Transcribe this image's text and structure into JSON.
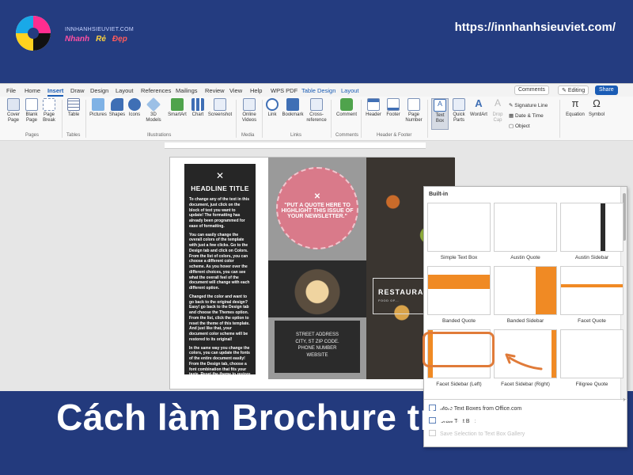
{
  "banner": {
    "logo_text": "INNHANHSIEUVIET.COM",
    "tagline_1": "Nhanh",
    "tagline_2": "Rẻ",
    "tagline_3": "Đẹp",
    "url": "https://innhanhsieuviet.com/"
  },
  "menu": {
    "tabs": [
      "File",
      "Home",
      "Insert",
      "Draw",
      "Design",
      "Layout",
      "References",
      "Mailings",
      "Review",
      "View",
      "Help",
      "WPS PDF",
      "Table Design",
      "Layout"
    ],
    "active_tab": "Insert",
    "comments_label": "Comments",
    "editing_label": "Editing",
    "share_label": "Share"
  },
  "ribbon": {
    "pages": {
      "cover": "Cover Page",
      "blank": "Blank Page",
      "break": "Page Break",
      "label": "Pages"
    },
    "tables": {
      "table": "Table",
      "label": "Tables"
    },
    "illustrations": {
      "pictures": "Pictures",
      "shapes": "Shapes",
      "icons": "Icons",
      "models": "3D Models",
      "smartart": "SmartArt",
      "chart": "Chart",
      "screenshot": "Screenshot",
      "label": "Illustrations"
    },
    "media": {
      "video": "Online Videos",
      "label": "Media"
    },
    "links": {
      "link": "Link",
      "bookmark": "Bookmark",
      "crossref": "Cross-reference",
      "label": "Links"
    },
    "comments": {
      "comment": "Comment",
      "label": "Comments"
    },
    "header_footer": {
      "header": "Header",
      "footer": "Footer",
      "page_number": "Page Number",
      "label": "Header & Footer"
    },
    "text": {
      "textbox": "Text Box",
      "quickparts": "Quick Parts",
      "wordart": "WordArt",
      "dropcap": "Drop Cap",
      "signature": "Signature Line",
      "datetime": "Date & Time",
      "object": "Object"
    },
    "symbols": {
      "equation": "Equation",
      "symbol": "Symbol"
    }
  },
  "brochure": {
    "headline": "HEADLINE TITLE",
    "paragraphs": [
      "To change any of the text in this document, just click on the block of text you want to update! The formatting has already been programmed for ease of formatting.",
      "You can easily change the overall colors of the template with just a few clicks. Go to the Design tab and click on Colors. From the list of colors, you can choose a different color scheme. As you hover over the different choices, you can see what the overall feel of the document will change with each different option.",
      "Changed the color and want to go back to the original design? Easy! go back to the Design tab and choose the Themes option. From the list, click the option to reset the theme of this template. And just like that, your document color scheme will be restored to its original!",
      "In the same way you change the colors, you can update the fonts of the entire document easily! From the Design tab, choose a font combination that fits your taste. Reset the theme to restore the template to its original state!"
    ],
    "quote": "\"PUT A QUOTE HERE TO HIGHLIGHT THIS ISSUE OF YOUR NEWSLETTER.\"",
    "address_lines": [
      "STREET ADDRESS",
      "CITY, ST ZIP CODE.",
      "PHONE NUMBER",
      "WEBSITE"
    ],
    "restaurant": "RESTAURA",
    "restaurant_sub": "FOOD OF..."
  },
  "textbox_menu": {
    "section": "Built-in",
    "items": [
      {
        "caption": "Simple Text Box"
      },
      {
        "caption": "Austin Quote"
      },
      {
        "caption": "Austin Sidebar"
      },
      {
        "caption": "Banded Quote"
      },
      {
        "caption": "Banded Sidebar"
      },
      {
        "caption": "Facet Quote"
      },
      {
        "caption": "Facet Sidebar (Left)"
      },
      {
        "caption": "Facet Sidebar (Right)"
      },
      {
        "caption": "Filigree Quote"
      }
    ],
    "more": "More Text Boxes from Office.com",
    "draw": "Draw Text Box",
    "save": "Save Selection to Text Box Gallery"
  },
  "title": "Cách làm Brochure trên word",
  "colors": {
    "banner": "#243c80",
    "accent": "#e07b39",
    "word_blue": "#1a5cb5"
  }
}
